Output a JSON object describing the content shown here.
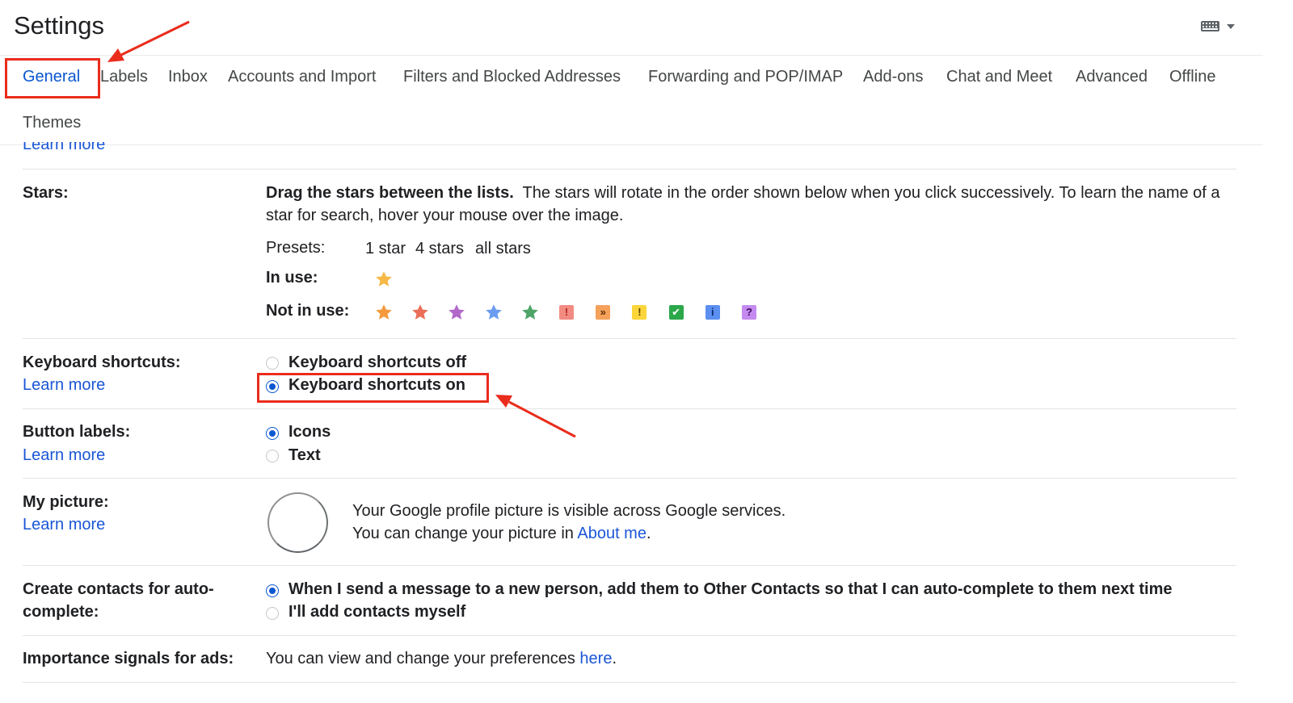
{
  "header": {
    "title": "Settings",
    "input_tools_icon": "keyboard-icon"
  },
  "tabs": [
    {
      "label": "General",
      "active": true
    },
    {
      "label": "Labels"
    },
    {
      "label": "Inbox"
    },
    {
      "label": "Accounts and Import"
    },
    {
      "label": "Filters and Blocked Addresses"
    },
    {
      "label": "Forwarding and POP/IMAP"
    },
    {
      "label": "Add-ons"
    },
    {
      "label": "Chat and Meet"
    },
    {
      "label": "Advanced"
    },
    {
      "label": "Offline"
    },
    {
      "label": "Themes"
    }
  ],
  "clipped_learn_more": "Learn more",
  "stars": {
    "label": "Stars:",
    "desc_bold": "Drag the stars between the lists.",
    "desc_line1": "The stars will rotate in the order shown below when you click successively. To learn the name of a",
    "desc_line2": "star for search, hover your mouse over the image.",
    "presets_label": "Presets:",
    "presets": [
      "1 star",
      "4 stars",
      "all stars"
    ],
    "in_use_label": "In use:",
    "in_use": [
      {
        "icon": "yellow-star",
        "color": "#f7b846"
      }
    ],
    "not_in_use_label": "Not in use:",
    "not_in_use": [
      {
        "icon": "orange-star",
        "color": "#f49a3c"
      },
      {
        "icon": "red-star",
        "color": "#ea6e58"
      },
      {
        "icon": "purple-star",
        "color": "#b168c9"
      },
      {
        "icon": "blue-star",
        "color": "#6c9cf1"
      },
      {
        "icon": "green-star",
        "color": "#4fa468"
      },
      {
        "icon": "red-bang",
        "glyph": "!",
        "bg": "#f28b82",
        "fg": "#b3261e"
      },
      {
        "icon": "orange-guillemet",
        "glyph": "»",
        "bg": "#f6a15b",
        "fg": "#5f2b00"
      },
      {
        "icon": "yellow-bang",
        "glyph": "!",
        "bg": "#fcd53b",
        "fg": "#5c4300"
      },
      {
        "icon": "green-check",
        "glyph": "✔",
        "bg": "#2ba84a",
        "fg": "#ffffff"
      },
      {
        "icon": "blue-info",
        "glyph": "i",
        "bg": "#5b8ff0",
        "fg": "#0b2d6e"
      },
      {
        "icon": "purple-question",
        "glyph": "?",
        "bg": "#c58af0",
        "fg": "#3b0a5c"
      }
    ]
  },
  "keyboard_shortcuts": {
    "label": "Keyboard shortcuts:",
    "learn_more": "Learn more",
    "options": [
      {
        "label": "Keyboard shortcuts off",
        "checked": false
      },
      {
        "label": "Keyboard shortcuts on",
        "checked": true
      }
    ]
  },
  "button_labels": {
    "label": "Button labels:",
    "learn_more": "Learn more",
    "options": [
      {
        "label": "Icons",
        "checked": true
      },
      {
        "label": "Text",
        "checked": false
      }
    ]
  },
  "my_picture": {
    "label": "My picture:",
    "learn_more": "Learn more",
    "line1": "Your Google profile picture is visible across Google services.",
    "line2_prefix": "You can change your picture in",
    "line2_link": "About me",
    "line2_suffix": "."
  },
  "create_contacts": {
    "label_line1": "Create contacts for auto-",
    "label_line2": "complete:",
    "options": [
      {
        "label": "When I send a message to a new person, add them to Other Contacts so that I can auto-complete to them next time",
        "checked": true
      },
      {
        "label": "I'll add contacts myself",
        "checked": false
      }
    ]
  },
  "importance_signals": {
    "label": "Importance signals for ads:",
    "text_prefix": "You can view and change your preferences",
    "link": "here",
    "text_suffix": "."
  },
  "annotation_color": "#ea2c1c"
}
